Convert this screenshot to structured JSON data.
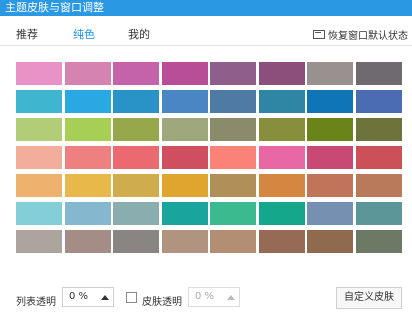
{
  "window": {
    "title": "主题皮肤与窗口调整"
  },
  "tabs": [
    {
      "label": "推荐",
      "active": false
    },
    {
      "label": "纯色",
      "active": true
    },
    {
      "label": "我的",
      "active": false
    }
  ],
  "restore": {
    "label": "恢复窗口默认状态",
    "icon": "window-restore-icon"
  },
  "colors": {
    "tab_active": "#1e8ee6",
    "titlebar": "#2b98e4"
  },
  "swatches": [
    [
      "#e892c8",
      "#d583b1",
      "#c463aa",
      "#b94e98",
      "#8f5e8b",
      "#8c4f7b",
      "#999090",
      "#6f6a70"
    ],
    [
      "#3fb5cf",
      "#2aa8e3",
      "#2993c8",
      "#4b86c4",
      "#4e7aa3",
      "#2e85a4",
      "#0f75b6",
      "#4b6cb3"
    ],
    [
      "#b2cd78",
      "#a8cf55",
      "#97a74c",
      "#9fa87c",
      "#8b8a6a",
      "#888f3c",
      "#69851a",
      "#6d733b"
    ],
    [
      "#f2ae9a",
      "#ee8080",
      "#ea6a70",
      "#cf4f5e",
      "#fb8279",
      "#e868a6",
      "#c84a74",
      "#cc5058"
    ],
    [
      "#eeb26e",
      "#e9b84a",
      "#cfad4c",
      "#e0a52f",
      "#b08f59",
      "#d58742",
      "#c0745a",
      "#b97a5b"
    ],
    [
      "#84cfd7",
      "#85b8ce",
      "#8aaeb0",
      "#19a59d",
      "#3bb98f",
      "#14a78c",
      "#7690b1",
      "#5c9699"
    ],
    [
      "#aba59e",
      "#a58d87",
      "#8a8583",
      "#b09480",
      "#b38e73",
      "#976a56",
      "#906a4f",
      "#6d7965"
    ]
  ],
  "footer": {
    "list_opacity_label": "列表透明",
    "list_opacity_value": "0 %",
    "skin_opacity_label": "皮肤透明",
    "skin_opacity_value": "0 %",
    "skin_opacity_checked": false,
    "custom_skin_label": "自定义皮肤"
  }
}
